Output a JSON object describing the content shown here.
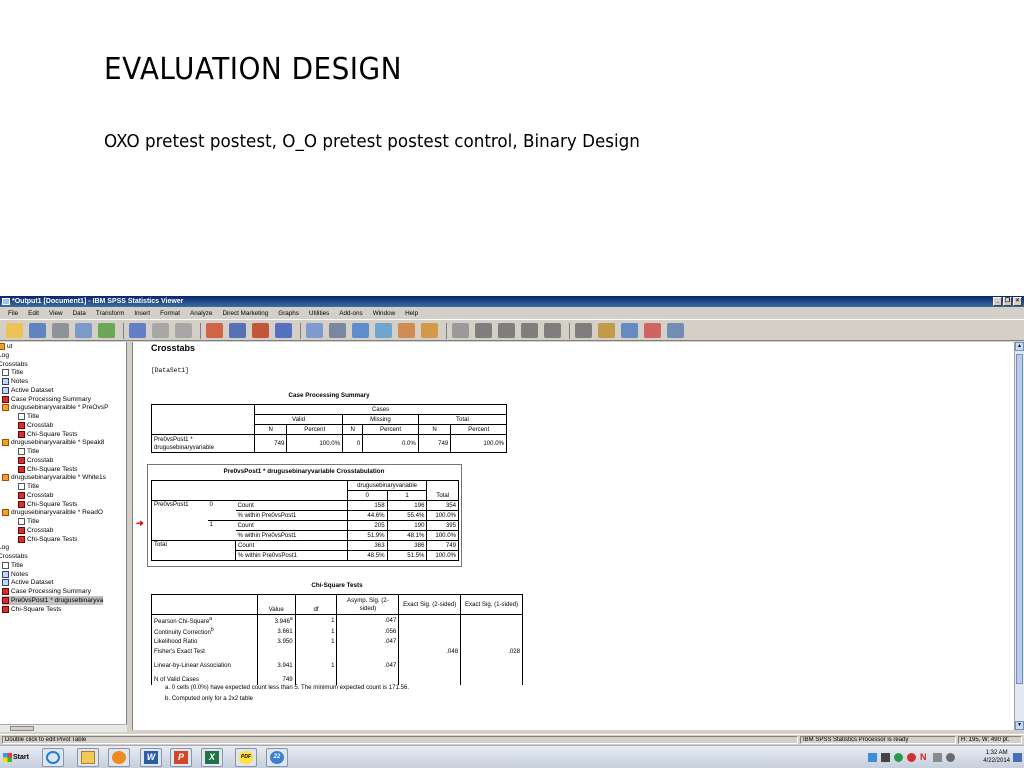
{
  "slide": {
    "title": "EVALUATION DESIGN",
    "subtitle": "OXO pretest postest, O_O pretest postest control, Binary Design"
  },
  "window": {
    "title": "*Output1 [Document1] - IBM SPSS Statistics Viewer",
    "controls": [
      "_",
      "×",
      "×"
    ]
  },
  "menu": [
    "File",
    "Edit",
    "View",
    "Data",
    "Transform",
    "Insert",
    "Format",
    "Analyze",
    "Direct Marketing",
    "Graphs",
    "Utilities",
    "Add-ons",
    "Window",
    "Help"
  ],
  "tree": [
    {
      "label": "ut",
      "icon": "book-icon",
      "indent": 0
    },
    {
      "label": "Log",
      "icon": "",
      "indent": 0
    },
    {
      "label": "Crosstabs",
      "icon": "",
      "indent": 0
    },
    {
      "label": "Title",
      "icon": "page-icon",
      "indent": 1
    },
    {
      "label": "Notes",
      "icon": "log-icon",
      "indent": 1
    },
    {
      "label": "Active Dataset",
      "icon": "log-icon",
      "indent": 1
    },
    {
      "label": "Case Processing Summary",
      "icon": "table-icon",
      "indent": 1
    },
    {
      "label": "drugusebinaryvaraible * PreOvsP",
      "icon": "book-icon",
      "indent": 1
    },
    {
      "label": "Title",
      "icon": "page-icon",
      "indent": 2
    },
    {
      "label": "Crosstab",
      "icon": "table-icon",
      "indent": 2
    },
    {
      "label": "Chi-Square Tests",
      "icon": "table-icon",
      "indent": 2
    },
    {
      "label": "drugusebinaryvaraible * Speak8",
      "icon": "book-icon",
      "indent": 1
    },
    {
      "label": "Title",
      "icon": "page-icon",
      "indent": 2
    },
    {
      "label": "Crosstab",
      "icon": "table-icon",
      "indent": 2
    },
    {
      "label": "Chi-Square Tests",
      "icon": "table-icon",
      "indent": 2
    },
    {
      "label": "drugusebinaryvaraible * White1s",
      "icon": "book-icon",
      "indent": 1
    },
    {
      "label": "Title",
      "icon": "page-icon",
      "indent": 2
    },
    {
      "label": "Crosstab",
      "icon": "table-icon",
      "indent": 2
    },
    {
      "label": "Chi-Square Tests",
      "icon": "table-icon",
      "indent": 2
    },
    {
      "label": "drugusebinaryvaraible * ReadO",
      "icon": "book-icon",
      "indent": 1
    },
    {
      "label": "Title",
      "icon": "page-icon",
      "indent": 2
    },
    {
      "label": "Crosstab",
      "icon": "table-icon",
      "indent": 2
    },
    {
      "label": "Chi-Square Tests",
      "icon": "table-icon",
      "indent": 2
    },
    {
      "label": "Log",
      "icon": "",
      "indent": 0
    },
    {
      "label": "Crosstabs",
      "icon": "",
      "indent": 0
    },
    {
      "label": "Title",
      "icon": "page-icon",
      "indent": 1
    },
    {
      "label": "Notes",
      "icon": "log-icon",
      "indent": 1
    },
    {
      "label": "Active Dataset",
      "icon": "log-icon",
      "indent": 1
    },
    {
      "label": "Case Processing Summary",
      "icon": "table-icon",
      "indent": 1
    },
    {
      "label": "Pre0vsPost1 * drugusebinaryva",
      "icon": "table-icon",
      "indent": 1,
      "selected": true
    },
    {
      "label": "Chi-Square Tests",
      "icon": "table-icon",
      "indent": 1
    }
  ],
  "output": {
    "heading": "Crosstabs",
    "dataset": "[DataSet1]",
    "case_summary": {
      "title": "Case Processing Summary",
      "group_header": "Cases",
      "col_groups": [
        "Valid",
        "Missing",
        "Total"
      ],
      "subheaders": [
        "N",
        "Percent",
        "N",
        "Percent",
        "N",
        "Percent"
      ],
      "row_label_1": "Pre0vsPost1 *",
      "row_label_2": "drugusebinaryvariable",
      "values": [
        "749",
        "100.0%",
        "0",
        "0.0%",
        "749",
        "100.0%"
      ]
    },
    "crosstab": {
      "title": "Pre0vsPost1 * drugusebinaryvariable Crosstabulation",
      "col_var": "drugusebinaryvariable",
      "cols": [
        "0",
        "1",
        "Total"
      ],
      "row_var": "Pre0vsPost1",
      "rows": [
        {
          "group": "0",
          "stat": "Count",
          "values": [
            "158",
            "196",
            "354"
          ]
        },
        {
          "group": "",
          "stat": "% within Pre0vsPost1",
          "values": [
            "44.6%",
            "55.4%",
            "100.0%"
          ]
        },
        {
          "group": "1",
          "stat": "Count",
          "values": [
            "205",
            "190",
            "395"
          ]
        },
        {
          "group": "",
          "stat": "% within Pre0vsPost1",
          "values": [
            "51.9%",
            "48.1%",
            "100.0%"
          ]
        }
      ],
      "total_label": "Total",
      "total_rows": [
        {
          "stat": "Count",
          "values": [
            "363",
            "386",
            "749"
          ]
        },
        {
          "stat": "% within Pre0vsPost1",
          "values": [
            "48.5%",
            "51.5%",
            "100.0%"
          ]
        }
      ]
    },
    "chisq": {
      "title": "Chi-Square Tests",
      "headers": [
        "Value",
        "df",
        "Asymp. Sig. (2-sided)",
        "Exact Sig. (2-sided)",
        "Exact Sig. (1-sided)"
      ],
      "rows": [
        {
          "label": "Pearson Chi-Square",
          "sup": "a",
          "value": "3.946",
          "df": "1",
          "asymp": ".047",
          "ex2": "",
          "ex1": ""
        },
        {
          "label": "Continuity Correction",
          "sup": "b",
          "value": "3.661",
          "df": "1",
          "asymp": ".056",
          "ex2": "",
          "ex1": ""
        },
        {
          "label": "Likelihood Ratio",
          "sup": "",
          "value": "3.950",
          "df": "1",
          "asymp": ".047",
          "ex2": "",
          "ex1": ""
        },
        {
          "label": "Fisher's Exact Test",
          "sup": "",
          "value": "",
          "df": "",
          "asymp": "",
          "ex2": ".048",
          "ex1": ".028"
        },
        {
          "label": "Linear-by-Linear Association",
          "sup": "",
          "value": "3.941",
          "df": "1",
          "asymp": ".047",
          "ex2": "",
          "ex1": ""
        },
        {
          "label": "N of Valid Cases",
          "sup": "",
          "value": "749",
          "df": "",
          "asymp": "",
          "ex2": "",
          "ex1": ""
        }
      ],
      "footnotes": [
        "a. 0 cells (0.0%) have expected count less than 5. The minimum expected count is 171.56.",
        "b. Computed only for a 2x2 table"
      ]
    }
  },
  "status": {
    "hint": "Double click to edit Pivot Table",
    "processor": "IBM SPSS Statistics Processor is ready",
    "size": "H: 195, W: 490 pt."
  },
  "taskbar": {
    "start": "start",
    "time": "1:32 AM",
    "date": "4/22/2014"
  },
  "colors": {
    "titlebar": "#0a246a",
    "arrow": "#ee0000",
    "chrome": "#d4d0c8"
  }
}
